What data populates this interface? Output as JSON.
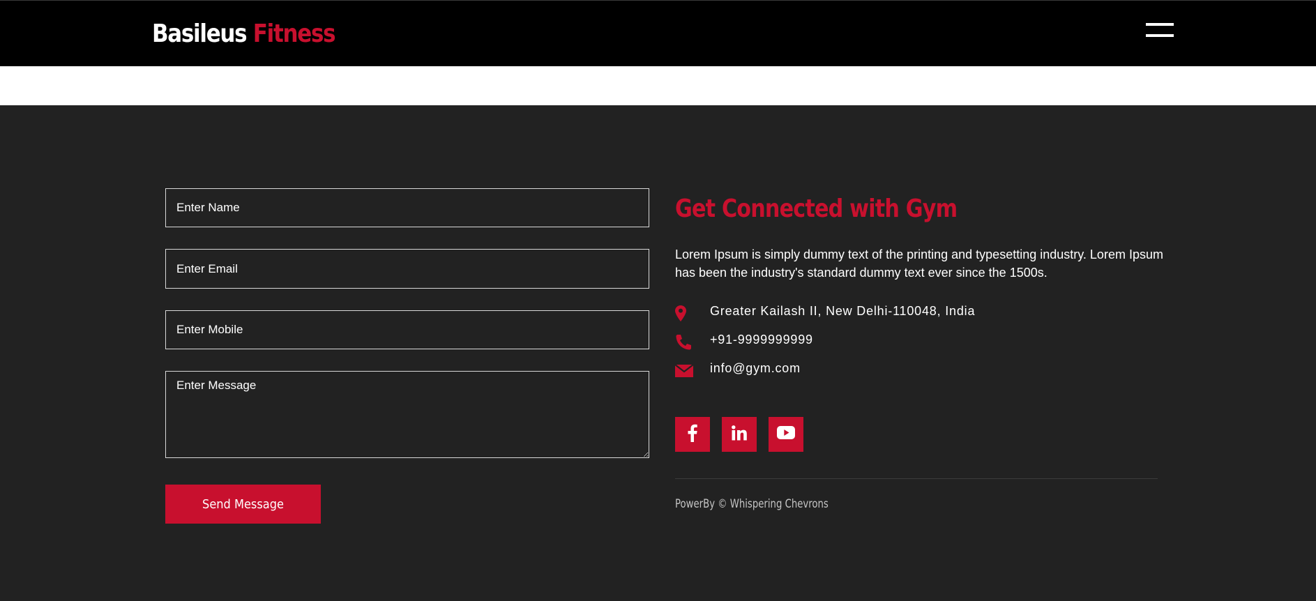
{
  "header": {
    "brand_part1": "Basileus",
    "brand_part2": "Fitness"
  },
  "contact_form": {
    "name_placeholder": "Enter Name",
    "email_placeholder": "Enter Email",
    "mobile_placeholder": "Enter Mobile",
    "message_placeholder": "Enter Message",
    "send_label": "Send Message"
  },
  "contact_info": {
    "heading": "Get Connected with Gym",
    "description": "Lorem Ipsum is simply dummy text of the printing and typesetting industry. Lorem Ipsum has been the industry's standard dummy text ever since the 1500s.",
    "address": "Greater Kailash II, New Delhi-110048, India",
    "phone": "+91-9999999999",
    "email": "info@gym.com",
    "icons": [
      "map-marker-icon",
      "phone-icon",
      "envelope-icon"
    ]
  },
  "social": [
    "facebook-icon",
    "linkedin-icon",
    "youtube-icon"
  ],
  "footer": {
    "copyright": "PowerBy © Whispering Chevrons"
  },
  "colors": {
    "accent": "#c8102e",
    "header_bg": "#000000",
    "footer_bg": "#222222",
    "text": "#ffffff"
  }
}
